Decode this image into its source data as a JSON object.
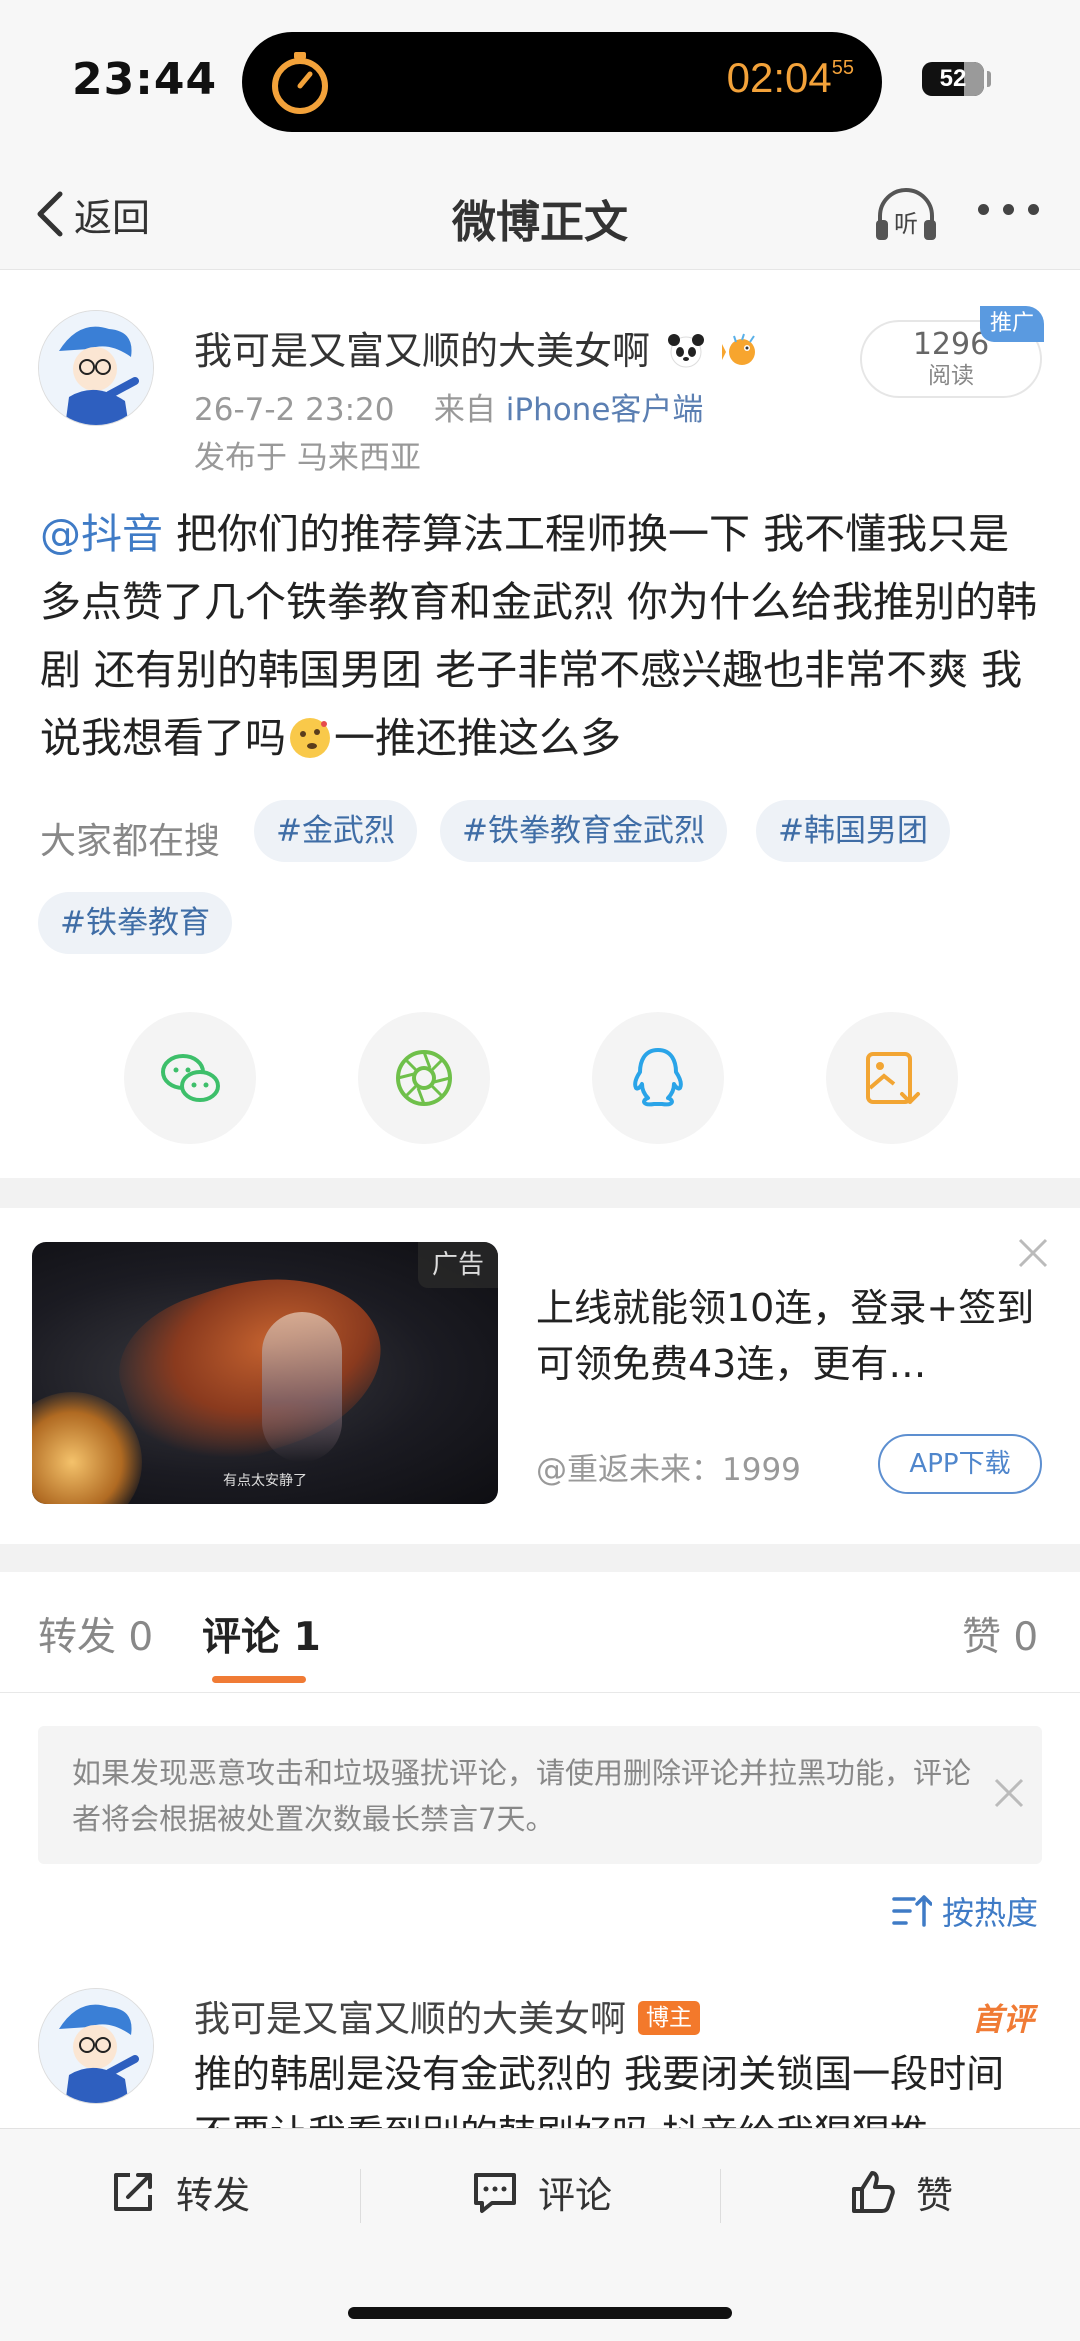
{
  "status_bar": {
    "time": "23:44",
    "timer": "02:04",
    "timer_seconds": "55",
    "battery": "52"
  },
  "nav": {
    "back_label": "返回",
    "title": "微博正文",
    "listen_label": "听"
  },
  "post": {
    "author": "我可是又富又顺的大美女啊",
    "timestamp": "26-7-2 23:20",
    "source_prefix": "来自",
    "source": "iPhone客户端",
    "location": "发布于 马来西亚",
    "reads_count": "1296",
    "reads_label": "阅读",
    "promo_badge": "推广",
    "mention": "@抖音",
    "body_part1": " 把你们的推荐算法工程师换一下 我不懂我只是多点赞了几个铁拳教育和金武烈 你为什么给我推别的韩剧 还有别的韩国男团 老子非常不感兴趣也非常不爽 我说我想看了吗",
    "body_part2": "一推还推这么多"
  },
  "hot_search": {
    "label": "大家都在搜",
    "tags": [
      "#金武烈",
      "#铁拳教育金武烈",
      "#韩国男团",
      "#铁拳教育"
    ]
  },
  "share": {
    "icons": [
      "wechat-icon",
      "moments-icon",
      "qq-icon",
      "save-image-icon"
    ],
    "colors": {
      "wechat": "#3dbf6a",
      "moments": "#6fc04a",
      "qq": "#2aa4e8",
      "save": "#f2a533"
    }
  },
  "ad": {
    "tag": "广告",
    "image_caption": "有点太安静了",
    "text": "上线就能领10连，登录+签到可领免费43连，更有…",
    "source": "@重返未来：1999",
    "button": "APP下载"
  },
  "tabs": {
    "repost": "转发 0",
    "comment": "评论 1",
    "like": "赞 0"
  },
  "notice": "如果发现恶意攻击和垃圾骚扰评论，请使用删除评论并拉黑功能，评论者将会根据被处置次数最长禁言7天。",
  "sort_label": "按热度",
  "comment": {
    "author": "我可是又富又顺的大美女啊",
    "badge": "博主",
    "first_label": "首评",
    "text": "推的韩剧是没有金武烈的 我要闭关锁国一段时间不要让我看到别的韩剧好吗 抖音给我猩猩推"
  },
  "bottom_bar": {
    "repost": "转发",
    "comment": "评论",
    "like": "赞"
  },
  "colors": {
    "accent_orange": "#f07b35",
    "link_blue": "#3f7bc6",
    "tag_bg": "#eef2f7"
  }
}
